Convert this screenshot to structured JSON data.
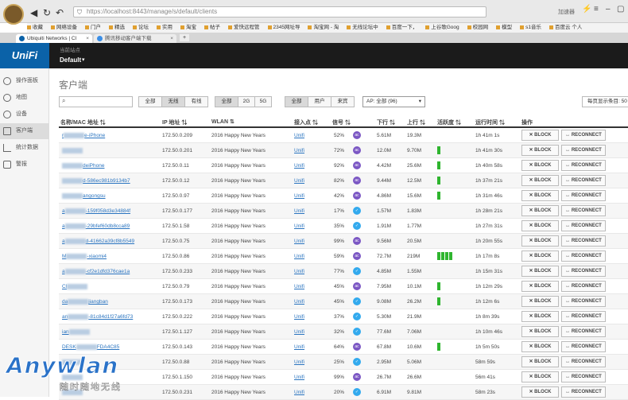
{
  "browser": {
    "url": "https://localhost:8443/manage/s/default/clients",
    "top_right_label": "加速器",
    "bookmarks": [
      "收藏",
      "网络设备",
      "门户",
      "精选",
      "论坛",
      "实用",
      "淘宝",
      "帖子",
      "爱快远程管",
      "2345网址导",
      "淘宝网 - 淘",
      "无线论坛中",
      "百度一下，",
      "上谷歌Goog",
      "校园网",
      "模型",
      "s1音乐",
      "百度云 个人"
    ],
    "tabs": [
      {
        "label": "Ubiquiti Networks | Cl"
      },
      {
        "label": "腾讯移动客户端下载"
      }
    ]
  },
  "app": {
    "logo": "UniFi",
    "site_label": "当前站点",
    "site_name": "Default"
  },
  "sidebar": {
    "items": [
      {
        "label": "操作面板",
        "icon": "dashboard-icon"
      },
      {
        "label": "地图",
        "icon": "map-icon"
      },
      {
        "label": "设备",
        "icon": "devices-icon"
      },
      {
        "label": "客户端",
        "icon": "clients-icon"
      },
      {
        "label": "统计数据",
        "icon": "stats-icon"
      },
      {
        "label": "警报",
        "icon": "alerts-icon"
      }
    ]
  },
  "page": {
    "title": "客户端",
    "filter_conn": [
      "全部",
      "无线",
      "有线"
    ],
    "filter_band": [
      "全部",
      "2G",
      "5G"
    ],
    "filter_type": [
      "全部",
      "用户",
      "来宾"
    ],
    "ap_select": "AP: 全部 (96)",
    "per_page": "每页显示条目: 50"
  },
  "table": {
    "headers": [
      "名称/MAC 地址",
      "IP 地址",
      "WLAN",
      "接入点",
      "信号",
      "下行",
      "上行",
      "活跃度",
      "运行时间",
      "操作"
    ],
    "block_label": "BLOCK",
    "reconnect_label": "RECONNECT",
    "rows": [
      {
        "name_pre": "r",
        "name_post": "e-iPhone",
        "ip": "172.50.0.209",
        "wlan": "2016 Happy New Years",
        "ap": "Unifi",
        "signal": "52%",
        "sig_type": "ac",
        "down": "5.61M",
        "up": "19.3M",
        "act": 0,
        "uptime": "1h 41m 1s"
      },
      {
        "name_pre": "",
        "name_post": "",
        "ip": "172.50.0.201",
        "wlan": "2016 Happy New Years",
        "ap": "Unifi",
        "signal": "72%",
        "sig_type": "ac",
        "down": "12.0M",
        "up": "9.70M",
        "act": 1,
        "uptime": "1h 41m 30s"
      },
      {
        "name_pre": "",
        "name_post": "deiPhone",
        "ip": "172.50.0.11",
        "wlan": "2016 Happy New Years",
        "ap": "Unifi",
        "signal": "92%",
        "sig_type": "ac",
        "down": "4.42M",
        "up": "25.6M",
        "act": 1,
        "uptime": "1h 40m 58s"
      },
      {
        "name_pre": "",
        "name_post": "d-586ec981b9134b7",
        "ip": "172.50.0.12",
        "wlan": "2016 Happy New Years",
        "ap": "Unifi",
        "signal": "82%",
        "sig_type": "ac",
        "down": "9.44M",
        "up": "12.5M",
        "act": 1,
        "uptime": "1h 37m 21s"
      },
      {
        "name_pre": "",
        "name_post": "angongsu",
        "ip": "172.50.0.97",
        "wlan": "2016 Happy New Years",
        "ap": "Unifi",
        "signal": "42%",
        "sig_type": "ac",
        "down": "4.86M",
        "up": "15.6M",
        "act": 1,
        "uptime": "1h 31m 46s"
      },
      {
        "name_pre": "a",
        "name_post": "-159f058d3e34884f",
        "ip": "172.50.0.177",
        "wlan": "2016 Happy New Years",
        "ap": "Unifi",
        "signal": "17%",
        "sig_type": "n",
        "down": "1.57M",
        "up": "1.83M",
        "act": 0,
        "uptime": "1h 28m 21s"
      },
      {
        "name_pre": "a",
        "name_post": "-29bfef60db8cca89",
        "ip": "172.50.1.58",
        "wlan": "2016 Happy New Years",
        "ap": "Unifi",
        "signal": "35%",
        "sig_type": "n",
        "down": "1.91M",
        "up": "1.77M",
        "act": 0,
        "uptime": "1h 27m 31s"
      },
      {
        "name_pre": "a",
        "name_post": "d-41662a39cf8b5549",
        "ip": "172.50.0.75",
        "wlan": "2016 Happy New Years",
        "ap": "Unifi",
        "signal": "99%",
        "sig_type": "ac",
        "down": "9.56M",
        "up": "20.5M",
        "act": 0,
        "uptime": "1h 20m 55s"
      },
      {
        "name_pre": "M",
        "name_post": "-xiaomi4",
        "ip": "172.50.0.86",
        "wlan": "2016 Happy New Years",
        "ap": "Unifi",
        "signal": "59%",
        "sig_type": "ac",
        "down": "72.7M",
        "up": "219M",
        "act": 4,
        "uptime": "1h 17m 8s"
      },
      {
        "name_pre": "a",
        "name_post": "-cf2e1dfd376cae1a",
        "ip": "172.50.0.233",
        "wlan": "2016 Happy New Years",
        "ap": "Unifi",
        "signal": "77%",
        "sig_type": "n",
        "down": "4.85M",
        "up": "1.55M",
        "act": 0,
        "uptime": "1h 15m 31s"
      },
      {
        "name_pre": "Cl",
        "name_post": "",
        "ip": "172.50.0.79",
        "wlan": "2016 Happy New Years",
        "ap": "Unifi",
        "signal": "45%",
        "sig_type": "ac",
        "down": "7.95M",
        "up": "10.1M",
        "act": 1,
        "uptime": "1h 12m 29s"
      },
      {
        "name_pre": "da",
        "name_post": "jiangban",
        "ip": "172.50.0.173",
        "wlan": "2016 Happy New Years",
        "ap": "Unifi",
        "signal": "45%",
        "sig_type": "n",
        "down": "9.08M",
        "up": "26.2M",
        "act": 1,
        "uptime": "1h 12m 6s"
      },
      {
        "name_pre": "an",
        "name_post": "-81c84d1f27a6fd73",
        "ip": "172.50.0.222",
        "wlan": "2016 Happy New Years",
        "ap": "Unifi",
        "signal": "37%",
        "sig_type": "n",
        "down": "5.30M",
        "up": "21.9M",
        "act": 0,
        "uptime": "1h 8m 39s"
      },
      {
        "name_pre": "ian",
        "name_post": "",
        "ip": "172.50.1.127",
        "wlan": "2016 Happy New Years",
        "ap": "Unifi",
        "signal": "32%",
        "sig_type": "n",
        "down": "77.6M",
        "up": "7.06M",
        "act": 0,
        "uptime": "1h 10m 46s"
      },
      {
        "name_pre": "DESK",
        "name_post": "FDA4C85",
        "ip": "172.50.0.143",
        "wlan": "2016 Happy New Years",
        "ap": "Unifi",
        "signal": "64%",
        "sig_type": "ac",
        "down": "67.8M",
        "up": "10.6M",
        "act": 1,
        "uptime": "1h 5m 50s"
      },
      {
        "name_pre": "",
        "name_post": "",
        "ip": "172.50.0.88",
        "wlan": "2016 Happy New Years",
        "ap": "Unifi",
        "signal": "25%",
        "sig_type": "n",
        "down": "2.95M",
        "up": "5.06M",
        "act": 0,
        "uptime": "58m 59s"
      },
      {
        "name_pre": "",
        "name_post": "",
        "ip": "172.50.1.150",
        "wlan": "2016 Happy New Years",
        "ap": "Unifi",
        "signal": "99%",
        "sig_type": "ac",
        "down": "26.7M",
        "up": "26.6M",
        "act": 0,
        "uptime": "56m 41s"
      },
      {
        "name_pre": "",
        "name_post": "",
        "ip": "172.50.0.231",
        "wlan": "2016 Happy New Years",
        "ap": "Unifi",
        "signal": "20%",
        "sig_type": "n",
        "down": "6.91M",
        "up": "9.81M",
        "act": 0,
        "uptime": "58m 23s"
      }
    ]
  },
  "watermark": {
    "title": "Anywlan",
    "subtitle": "随时随地无线"
  }
}
